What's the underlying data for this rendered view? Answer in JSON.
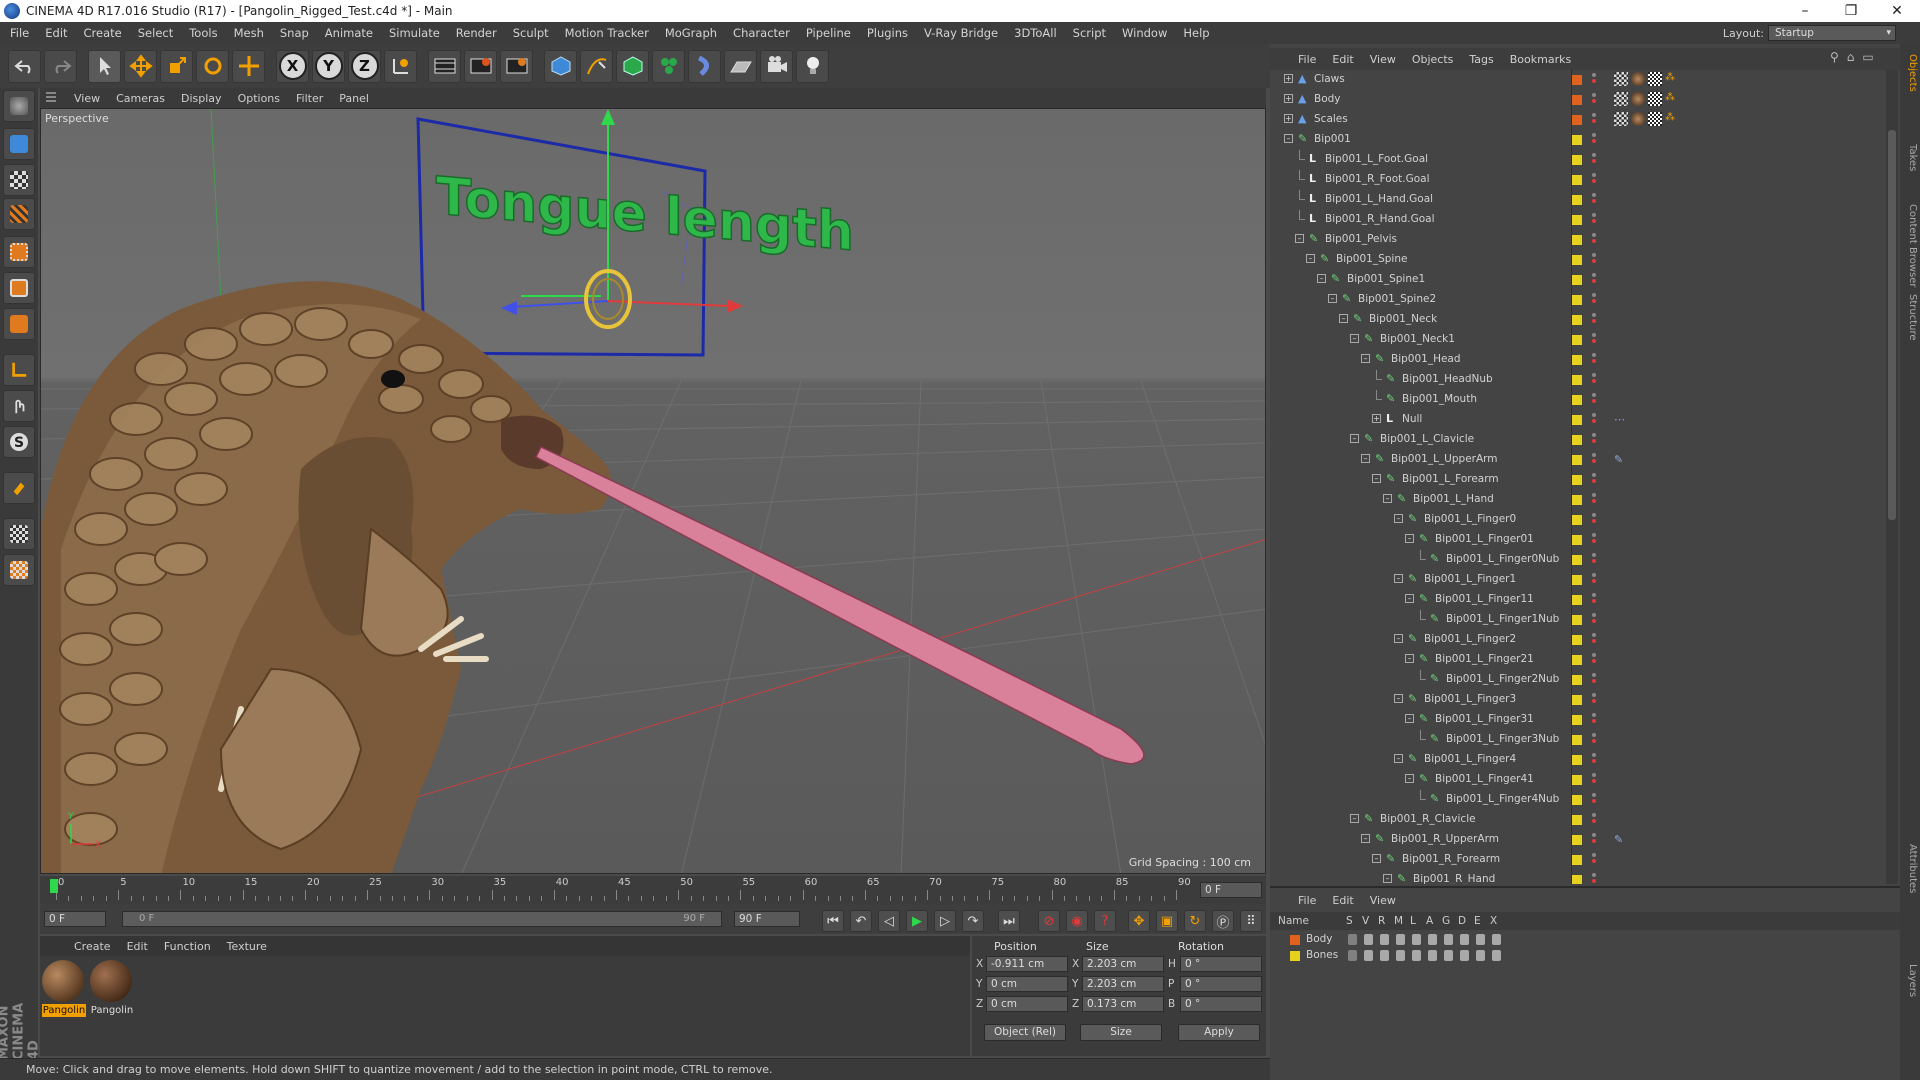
{
  "window": {
    "title": "CINEMA 4D R17.016 Studio (R17) - [Pangolin_Rigged_Test.c4d *] - Main",
    "min": "–",
    "max": "❐",
    "close": "✕"
  },
  "menu": [
    "File",
    "Edit",
    "Create",
    "Select",
    "Tools",
    "Mesh",
    "Snap",
    "Animate",
    "Simulate",
    "Render",
    "Sculpt",
    "Motion Tracker",
    "MoGraph",
    "Character",
    "Pipeline",
    "Plugins",
    "V-Ray Bridge",
    "3DToAll",
    "Script",
    "Window",
    "Help"
  ],
  "layout": {
    "label": "Layout:",
    "value": "Startup"
  },
  "toolbar": {
    "x": "X",
    "y": "Y",
    "z": "Z"
  },
  "viewport": {
    "menu": [
      "View",
      "Cameras",
      "Display",
      "Options",
      "Filter",
      "Panel"
    ],
    "label": "Perspective",
    "grid_spacing": "Grid Spacing : 100 cm",
    "overlay_text": "Tongue length",
    "axis_y": "Y",
    "axis_x": "X"
  },
  "timeline": {
    "ticks": [
      "0",
      "5",
      "10",
      "15",
      "20",
      "25",
      "30",
      "35",
      "40",
      "45",
      "50",
      "55",
      "60",
      "65",
      "70",
      "75",
      "80",
      "85",
      "90"
    ],
    "current": "0 F"
  },
  "timectrl": {
    "start": "0 F",
    "range_start": "0 F",
    "range_end": "90 F",
    "end": "90 F"
  },
  "materials": {
    "menu": [
      "Create",
      "Edit",
      "Function",
      "Texture"
    ],
    "items": [
      "Pangolin",
      "Pangolin"
    ]
  },
  "coords": {
    "headers": {
      "position": "Position",
      "size": "Size",
      "rotation": "Rotation"
    },
    "rows": [
      {
        "axis": "X",
        "pos": "-0.911 cm",
        "saxis": "X",
        "size": "2.203 cm",
        "raxis": "H",
        "rot": "0 °"
      },
      {
        "axis": "Y",
        "pos": "0 cm",
        "saxis": "Y",
        "size": "2.203 cm",
        "raxis": "P",
        "rot": "0 °"
      },
      {
        "axis": "Z",
        "pos": "0 cm",
        "saxis": "Z",
        "size": "0.173 cm",
        "raxis": "B",
        "rot": "0 °"
      }
    ],
    "mode": "Object (Rel)",
    "size_mode": "Size",
    "apply": "Apply"
  },
  "status": "Move: Click and drag to move elements. Hold down SHIFT to quantize movement / add to the selection in point mode, CTRL to remove.",
  "objects": {
    "menu": [
      "File",
      "Edit",
      "View",
      "Objects",
      "Tags",
      "Bookmarks"
    ],
    "rows": [
      {
        "name": "Claws",
        "depth": 0,
        "exp": "+",
        "type": "mesh",
        "layer": "#e0621e",
        "tags": "material"
      },
      {
        "name": "Body",
        "depth": 0,
        "exp": "+",
        "type": "mesh",
        "layer": "#e0621e",
        "tags": "material"
      },
      {
        "name": "Scales",
        "depth": 0,
        "exp": "+",
        "type": "mesh",
        "layer": "#e0621e",
        "tags": "material"
      },
      {
        "name": "Bip001",
        "depth": 0,
        "exp": "-",
        "type": "bone",
        "layer": "#e6d21e",
        "tags": ""
      },
      {
        "name": "Bip001_L_Foot.Goal",
        "depth": 1,
        "exp": "",
        "type": "null",
        "layer": "#e6d21e",
        "tags": ""
      },
      {
        "name": "Bip001_R_Foot.Goal",
        "depth": 1,
        "exp": "",
        "type": "null",
        "layer": "#e6d21e",
        "tags": ""
      },
      {
        "name": "Bip001_L_Hand.Goal",
        "depth": 1,
        "exp": "",
        "type": "null",
        "layer": "#e6d21e",
        "tags": ""
      },
      {
        "name": "Bip001_R_Hand.Goal",
        "depth": 1,
        "exp": "",
        "type": "null",
        "layer": "#e6d21e",
        "tags": ""
      },
      {
        "name": "Bip001_Pelvis",
        "depth": 1,
        "exp": "-",
        "type": "bone",
        "layer": "#e6d21e",
        "tags": ""
      },
      {
        "name": "Bip001_Spine",
        "depth": 2,
        "exp": "-",
        "type": "bone",
        "layer": "#e6d21e",
        "tags": ""
      },
      {
        "name": "Bip001_Spine1",
        "depth": 3,
        "exp": "-",
        "type": "bone",
        "layer": "#e6d21e",
        "tags": ""
      },
      {
        "name": "Bip001_Spine2",
        "depth": 4,
        "exp": "-",
        "type": "bone",
        "layer": "#e6d21e",
        "tags": ""
      },
      {
        "name": "Bip001_Neck",
        "depth": 5,
        "exp": "-",
        "type": "bone",
        "layer": "#e6d21e",
        "tags": ""
      },
      {
        "name": "Bip001_Neck1",
        "depth": 6,
        "exp": "-",
        "type": "bone",
        "layer": "#e6d21e",
        "tags": ""
      },
      {
        "name": "Bip001_Head",
        "depth": 7,
        "exp": "-",
        "type": "bone",
        "layer": "#e6d21e",
        "tags": ""
      },
      {
        "name": "Bip001_HeadNub",
        "depth": 8,
        "exp": "",
        "type": "bone",
        "layer": "#e6d21e",
        "tags": ""
      },
      {
        "name": "Bip001_Mouth",
        "depth": 8,
        "exp": "",
        "type": "bone",
        "layer": "#e6d21e",
        "tags": ""
      },
      {
        "name": "Null",
        "depth": 8,
        "exp": "+",
        "type": "null",
        "layer": "#e6d21e",
        "tags": "xpresso"
      },
      {
        "name": "Bip001_L_Clavicle",
        "depth": 6,
        "exp": "-",
        "type": "bone",
        "layer": "#e6d21e",
        "tags": ""
      },
      {
        "name": "Bip001_L_UpperArm",
        "depth": 7,
        "exp": "-",
        "type": "bone",
        "layer": "#e6d21e",
        "tags": "ik"
      },
      {
        "name": "Bip001_L_Forearm",
        "depth": 8,
        "exp": "-",
        "type": "bone",
        "layer": "#e6d21e",
        "tags": ""
      },
      {
        "name": "Bip001_L_Hand",
        "depth": 9,
        "exp": "-",
        "type": "bone",
        "layer": "#e6d21e",
        "tags": ""
      },
      {
        "name": "Bip001_L_Finger0",
        "depth": 10,
        "exp": "-",
        "type": "bone",
        "layer": "#e6d21e",
        "tags": ""
      },
      {
        "name": "Bip001_L_Finger01",
        "depth": 11,
        "exp": "-",
        "type": "bone",
        "layer": "#e6d21e",
        "tags": ""
      },
      {
        "name": "Bip001_L_Finger0Nub",
        "depth": 12,
        "exp": "",
        "type": "bone",
        "layer": "#e6d21e",
        "tags": ""
      },
      {
        "name": "Bip001_L_Finger1",
        "depth": 10,
        "exp": "-",
        "type": "bone",
        "layer": "#e6d21e",
        "tags": ""
      },
      {
        "name": "Bip001_L_Finger11",
        "depth": 11,
        "exp": "-",
        "type": "bone",
        "layer": "#e6d21e",
        "tags": ""
      },
      {
        "name": "Bip001_L_Finger1Nub",
        "depth": 12,
        "exp": "",
        "type": "bone",
        "layer": "#e6d21e",
        "tags": ""
      },
      {
        "name": "Bip001_L_Finger2",
        "depth": 10,
        "exp": "-",
        "type": "bone",
        "layer": "#e6d21e",
        "tags": ""
      },
      {
        "name": "Bip001_L_Finger21",
        "depth": 11,
        "exp": "-",
        "type": "bone",
        "layer": "#e6d21e",
        "tags": ""
      },
      {
        "name": "Bip001_L_Finger2Nub",
        "depth": 12,
        "exp": "",
        "type": "bone",
        "layer": "#e6d21e",
        "tags": ""
      },
      {
        "name": "Bip001_L_Finger3",
        "depth": 10,
        "exp": "-",
        "type": "bone",
        "layer": "#e6d21e",
        "tags": ""
      },
      {
        "name": "Bip001_L_Finger31",
        "depth": 11,
        "exp": "-",
        "type": "bone",
        "layer": "#e6d21e",
        "tags": ""
      },
      {
        "name": "Bip001_L_Finger3Nub",
        "depth": 12,
        "exp": "",
        "type": "bone",
        "layer": "#e6d21e",
        "tags": ""
      },
      {
        "name": "Bip001_L_Finger4",
        "depth": 10,
        "exp": "-",
        "type": "bone",
        "layer": "#e6d21e",
        "tags": ""
      },
      {
        "name": "Bip001_L_Finger41",
        "depth": 11,
        "exp": "-",
        "type": "bone",
        "layer": "#e6d21e",
        "tags": ""
      },
      {
        "name": "Bip001_L_Finger4Nub",
        "depth": 12,
        "exp": "",
        "type": "bone",
        "layer": "#e6d21e",
        "tags": ""
      },
      {
        "name": "Bip001_R_Clavicle",
        "depth": 6,
        "exp": "-",
        "type": "bone",
        "layer": "#e6d21e",
        "tags": ""
      },
      {
        "name": "Bip001_R_UpperArm",
        "depth": 7,
        "exp": "-",
        "type": "bone",
        "layer": "#e6d21e",
        "tags": "ik"
      },
      {
        "name": "Bip001_R_Forearm",
        "depth": 8,
        "exp": "-",
        "type": "bone",
        "layer": "#e6d21e",
        "tags": ""
      },
      {
        "name": "Bip001_R_Hand",
        "depth": 9,
        "exp": "-",
        "type": "bone",
        "layer": "#e6d21e",
        "tags": ""
      }
    ]
  },
  "layers": {
    "menu": [
      "File",
      "Edit",
      "View"
    ],
    "columns": [
      "Name",
      "S",
      "V",
      "R",
      "M",
      "L",
      "A",
      "G",
      "D",
      "E",
      "X"
    ],
    "rows": [
      {
        "name": "Body",
        "color": "#e0621e"
      },
      {
        "name": "Bones",
        "color": "#e6d21e"
      }
    ]
  },
  "side_tabs": [
    "Objects",
    "Takes",
    "Content Browser",
    "Structure",
    "Attributes",
    "Layers"
  ],
  "brand": "MAXON CINEMA 4D",
  "colors": {
    "accent": "#f2a000",
    "bone": "#6fd37a",
    "tongue": "#d9809a",
    "text3d": "#2fb84a"
  }
}
